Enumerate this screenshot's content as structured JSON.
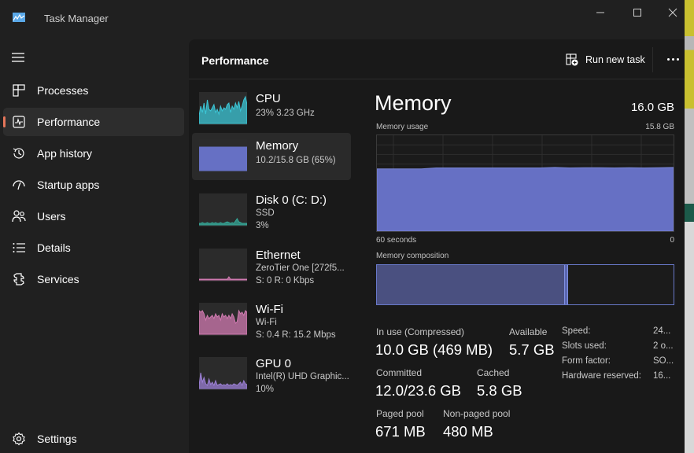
{
  "window": {
    "title": "Task Manager",
    "controls": [
      "minimize",
      "maximize",
      "close"
    ]
  },
  "nav": {
    "items": [
      {
        "label": "Processes",
        "icon": "processes-icon"
      },
      {
        "label": "Performance",
        "icon": "performance-icon",
        "active": true
      },
      {
        "label": "App history",
        "icon": "history-icon"
      },
      {
        "label": "Startup apps",
        "icon": "startup-icon"
      },
      {
        "label": "Users",
        "icon": "users-icon"
      },
      {
        "label": "Details",
        "icon": "details-icon"
      },
      {
        "label": "Services",
        "icon": "services-icon"
      }
    ],
    "settings_label": "Settings"
  },
  "header": {
    "title": "Performance",
    "run_task_label": "Run new task"
  },
  "devices": [
    {
      "name": "CPU",
      "line1": "23%  3.23 GHz",
      "line2": "",
      "color": "#3cc6d6"
    },
    {
      "name": "Memory",
      "line1": "10.2/15.8 GB (65%)",
      "line2": "",
      "color": "#6670c4",
      "active": true
    },
    {
      "name": "Disk 0 (C: D:)",
      "line1": "SSD",
      "line2": "3%",
      "color": "#35a898"
    },
    {
      "name": "Ethernet",
      "line1": "ZeroTier One [272f5...",
      "line2": "S: 0  R: 0 Kbps",
      "color": "#d07ab0"
    },
    {
      "name": "Wi-Fi",
      "line1": "Wi-Fi",
      "line2": "S: 0.4  R: 15.2 Mbps",
      "color": "#d07ab0"
    },
    {
      "name": "GPU 0",
      "line1": "Intel(R) UHD Graphic...",
      "line2": "10%",
      "color": "#9b7fd4"
    }
  ],
  "detail": {
    "title": "Memory",
    "total": "16.0 GB",
    "usage_label": "Memory usage",
    "usage_max": "15.8 GB",
    "time_left": "60 seconds",
    "time_right": "0",
    "composition_label": "Memory composition",
    "usage_fraction": 0.65,
    "composition": {
      "in_use_fraction": 0.635,
      "modified_fraction": 0.01
    },
    "stats": {
      "in_use_label": "In use (Compressed)",
      "in_use_value": "10.0 GB (469 MB)",
      "available_label": "Available",
      "available_value": "5.7 GB",
      "committed_label": "Committed",
      "committed_value": "12.0/23.6 GB",
      "cached_label": "Cached",
      "cached_value": "5.8 GB",
      "paged_label": "Paged pool",
      "paged_value": "671 MB",
      "nonpaged_label": "Non-paged pool",
      "nonpaged_value": "480 MB"
    },
    "specs": [
      {
        "label": "Speed:",
        "value": "24..."
      },
      {
        "label": "Slots used:",
        "value": "2 o..."
      },
      {
        "label": "Form factor:",
        "value": "SO..."
      },
      {
        "label": "Hardware reserved:",
        "value": "16..."
      }
    ]
  }
}
